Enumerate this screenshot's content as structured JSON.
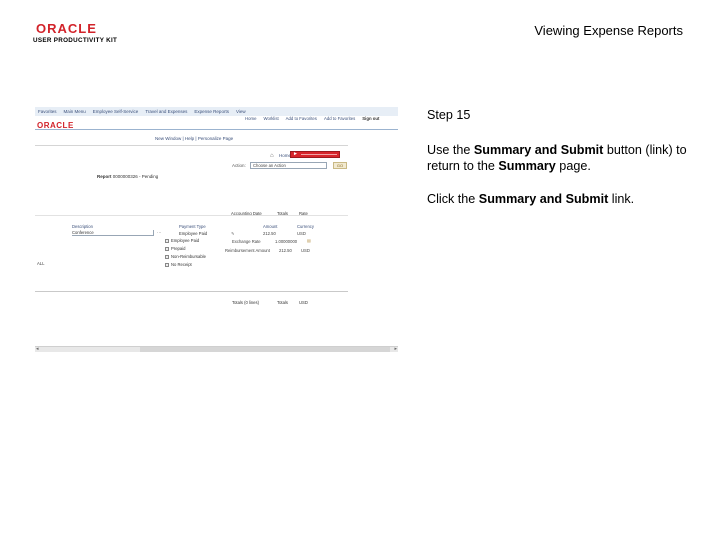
{
  "slide": {
    "logo_brand": "ORACLE",
    "logo_product": "USER PRODUCTIVITY KIT",
    "title": "Viewing Expense Reports"
  },
  "instructions": {
    "step": "Step 15",
    "para1_pre": "Use the ",
    "para1_bold1": "Summary and Submit",
    "para1_mid": " button (link) to return to the ",
    "para1_bold2": "Summary",
    "para1_post": " page.",
    "para2_pre": "Click the ",
    "para2_bold": "Summary and Submit",
    "para2_post": " link."
  },
  "colors": {
    "oracle_red": "#d2232a",
    "highlight_red": "#d7262c",
    "menu_bg": "#e7eef6",
    "link_blue": "#3a4f7a"
  },
  "screenshot": {
    "logo": "ORACLE",
    "menu": [
      "Favorites",
      "Main Menu",
      "Employee Self-Service",
      "Travel and Expenses",
      "Expense Reports",
      "View"
    ],
    "nav": [
      "Home",
      "Worklist",
      "Add to Favorites",
      "Add to Favorites",
      "Sign out"
    ],
    "sublinks": "New Window | Help | Personalize Page",
    "home_link": "Home",
    "action_label": "Action:",
    "action_value": "Choose an Action",
    "go_label": "GO",
    "report_label": "Report",
    "report_value": "0000000326 - Pending",
    "col_headers": [
      "Accounting Date",
      "Totals",
      "Rate"
    ],
    "tbl_headers": [
      "Description",
      "Payment Type",
      "Amount",
      "Currency"
    ],
    "desc_value": "Conference",
    "payment_rows": [
      {
        "label": "Employee Paid",
        "checked": true
      },
      {
        "label": "Prepaid",
        "checked": false
      },
      {
        "label": "Non-Reimbursable",
        "checked": false
      },
      {
        "label": "No Receipt",
        "checked": false
      }
    ],
    "amount": "212.50",
    "currency": "USD",
    "exchange_label": "Exchange Rate",
    "exchange_value": "1.00000000",
    "reimb_label": "Reimbursement Amount",
    "reimb_value": "212.50",
    "reimb_currency": "USD",
    "side_label": "ALL",
    "totals_label": "Totals (0 lines)",
    "totals_value": "Totals",
    "totals_rate": "USD"
  }
}
